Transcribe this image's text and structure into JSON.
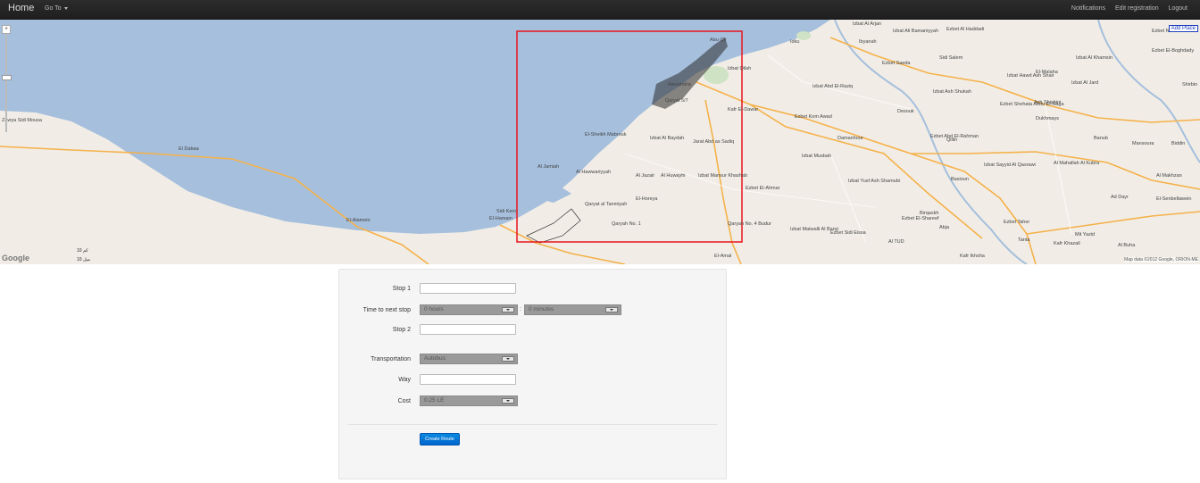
{
  "navbar": {
    "brand": "Home",
    "goto_label": "Go To",
    "right_links": [
      "Notifications",
      "Edit registration",
      "Logout"
    ]
  },
  "map": {
    "zoom_in": "+",
    "zoom_out": "−",
    "add_place": "Add Place",
    "logo": "Google",
    "attribution": "Map data ©2012 Google, ORION-ME",
    "scale_km": "10 كم",
    "scale_mi": "10 ميل",
    "labels": [
      "Izbat Al Arjan",
      "Ezbet Al Haddadi",
      "Izbat Ali Bamaniyyah",
      "Ibyanah",
      "Idku",
      "Abu Qir",
      "Izbat Qilah",
      "Sidi Salem",
      "Ezbet Saeda",
      "Izbat Hawd Ash Shair",
      "El-Malaha",
      "Izbat Al Khamsin",
      "Ezbet No. 33",
      "Ezbet El-Boghdady",
      "Izbat Al Jard",
      "Shirbin",
      "Alexandria",
      "Qaryat 5/7",
      "Kafr El-Dawar",
      "Izbat Ash Shukah",
      "Ezbet Shehata Abou El-Naga",
      "Ash Shishini",
      "Dukhmays",
      "Izbat Abd El-Raziq",
      "Ezbet Kom Awad",
      "Desouk",
      "Qillin",
      "Banub",
      "Mansoura",
      "Biddin",
      "Zawya Sidi Mousa",
      "El Dabaa",
      "Sidi Kerir",
      "El-Sheikh Mabrouk",
      "Izbat Al Baydah",
      "Jarat Abd as Sadiq",
      "Damanhour",
      "Izbat Musbah",
      "Ezbet Abd El-Rahman",
      "Al Jamiah",
      "Al Hawwariyyah",
      "Al Jazair",
      "Al Huwayhi",
      "Izbat Mansur Khashab",
      "Ezbet El-Ahmar",
      "Izbat Yusf Ash Shamubi",
      "Basioun",
      "Izbat Sayyid Al Qasrawi",
      "Al Mahallah Al Kubra",
      "Ad Dayr",
      "Al Makhzan",
      "El-Senbellawein",
      "El-Hamam",
      "El-Alamein",
      "Qaryat al Tanmiyah",
      "El-Horeya",
      "Qaryah No. 1",
      "Qaryah No. 4 Budur",
      "Birqaskh",
      "Ezbet El-Shareef",
      "Izbat Matwalli Al Barqi",
      "Ezbet Sidi Eissa",
      "Abja",
      "Ezbet Taher",
      "Tanta",
      "Mit Yazid",
      "Kafr Khazail",
      "Al Buha",
      "Al TUD",
      "El-Amal",
      "Kafr Ikhsha"
    ]
  },
  "form": {
    "stop1_label": "Stop 1",
    "stop1_value": "",
    "time_label": "Time to next stop",
    "hours_selected": "0 hours",
    "minutes_selected": "0 minutes",
    "time_separator": ":",
    "stop2_label": "Stop 2",
    "stop2_value": "",
    "transport_label": "Transportation",
    "transport_selected": "Autobus",
    "way_label": "Way",
    "way_value": "",
    "cost_label": "Cost",
    "cost_selected": "0.25 LE",
    "submit_label": "Create Route"
  },
  "colors": {
    "navbar": "#222222",
    "sea": "#a5bfdd",
    "land": "#f1ede6",
    "roads": "#f5b14a",
    "selection_box": "#e8151f",
    "primary_button": "#0074cc",
    "panel_bg": "#f5f5f5"
  }
}
